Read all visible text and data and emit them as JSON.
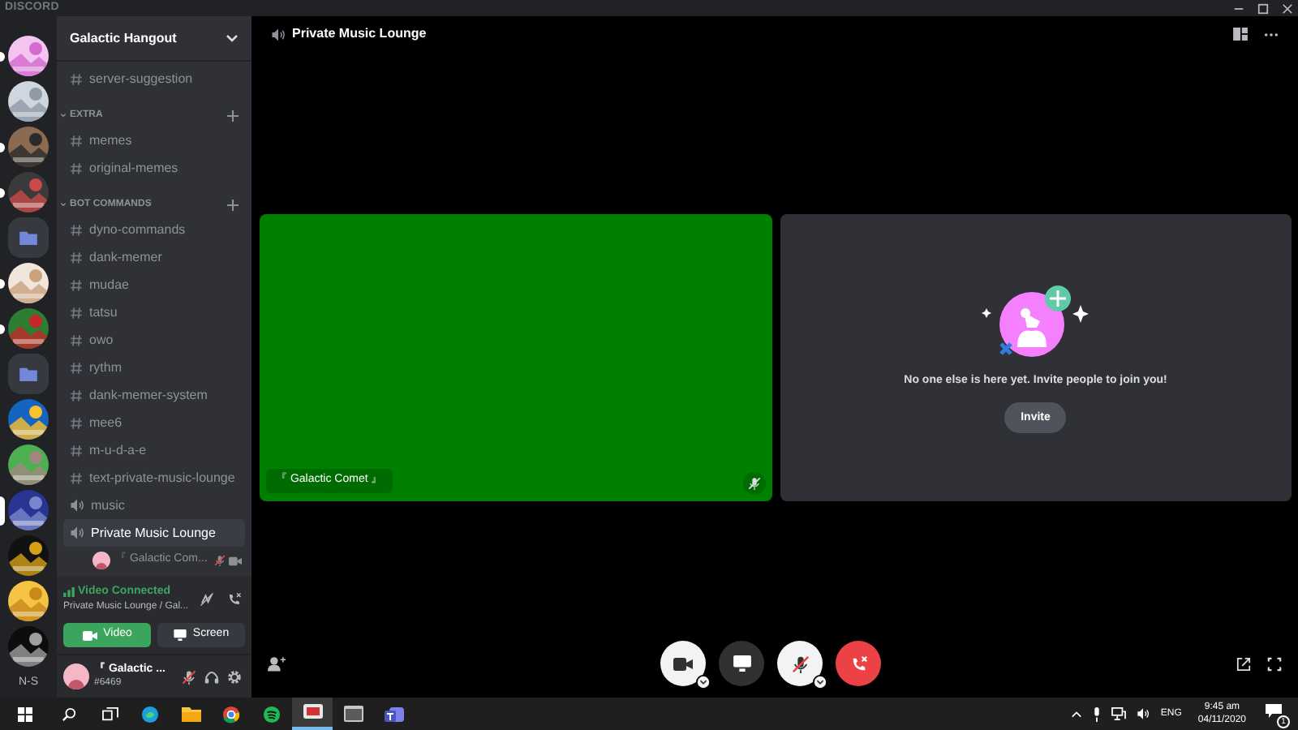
{
  "app_title": "DISCORD",
  "servers": [
    {
      "kind": "picture",
      "unread": true,
      "selected": false
    },
    {
      "kind": "picture",
      "unread": false,
      "selected": false
    },
    {
      "kind": "picture",
      "unread": true,
      "selected": false
    },
    {
      "kind": "picture",
      "unread": true,
      "selected": false
    },
    {
      "kind": "folder",
      "unread": false,
      "selected": false
    },
    {
      "kind": "picture",
      "unread": true,
      "selected": false
    },
    {
      "kind": "picture",
      "unread": true,
      "selected": false
    },
    {
      "kind": "folder",
      "unread": false,
      "selected": false
    },
    {
      "kind": "picture",
      "unread": false,
      "selected": false
    },
    {
      "kind": "picture",
      "unread": false,
      "selected": false
    },
    {
      "kind": "picture",
      "unread": false,
      "selected": true
    },
    {
      "kind": "picture",
      "unread": false,
      "selected": false
    },
    {
      "kind": "picture",
      "unread": false,
      "selected": false
    },
    {
      "kind": "picture",
      "unread": false,
      "selected": false
    }
  ],
  "server_more_label": "N-S",
  "guild_name": "Galactic Hangout",
  "channel_groups": [
    {
      "channels": [
        {
          "kind": "text",
          "name": "server-suggestion",
          "selected": false
        }
      ]
    },
    {
      "category": "EXTRA",
      "channels": [
        {
          "kind": "text",
          "name": "memes",
          "selected": false
        },
        {
          "kind": "text",
          "name": "original-memes",
          "selected": false
        }
      ]
    },
    {
      "category": "BOT COMMANDS",
      "channels": [
        {
          "kind": "text",
          "name": "dyno-commands",
          "selected": false
        },
        {
          "kind": "text",
          "name": "dank-memer",
          "selected": false
        },
        {
          "kind": "text",
          "name": "mudae",
          "selected": false
        },
        {
          "kind": "text",
          "name": "tatsu",
          "selected": false
        },
        {
          "kind": "text",
          "name": "owo",
          "selected": false
        },
        {
          "kind": "text",
          "name": "rythm",
          "selected": false
        },
        {
          "kind": "text",
          "name": "dank-memer-system",
          "selected": false
        },
        {
          "kind": "text",
          "name": "mee6",
          "selected": false
        },
        {
          "kind": "text",
          "name": "m-u-d-a-e",
          "selected": false
        },
        {
          "kind": "text",
          "name": "text-private-music-lounge",
          "selected": false
        },
        {
          "kind": "voice",
          "name": "music",
          "selected": false
        },
        {
          "kind": "voice",
          "name": "Private Music Lounge",
          "selected": true,
          "members": [
            {
              "name": "『 Galactic Com...",
              "muted": true,
              "video": true
            }
          ]
        }
      ]
    }
  ],
  "voice_status": {
    "title": "Video Connected",
    "subtitle": "Private Music Lounge / Gal..."
  },
  "voice_buttons": [
    {
      "kind": "video",
      "label": "Video",
      "selected": true
    },
    {
      "kind": "screen",
      "label": "Screen",
      "selected": false
    }
  ],
  "user": {
    "name": "『 Galactic ...",
    "tag": "#6469",
    "muted": true
  },
  "call": {
    "title": "Private Music Lounge",
    "tiles": [
      {
        "kind": "video",
        "name": "『 Galactic Comet 』",
        "muted": true
      },
      {
        "kind": "empty",
        "message": "No one else is here yet. Invite people to join you!",
        "button": "Invite"
      }
    ],
    "controls": [
      {
        "kind": "camera",
        "on": true
      },
      {
        "kind": "screen",
        "on": false
      },
      {
        "kind": "mute",
        "on": true
      },
      {
        "kind": "disconnect",
        "on": true
      }
    ]
  },
  "taskbar": {
    "apps": [
      {
        "kind": "edge",
        "selected": false
      },
      {
        "kind": "explorer",
        "selected": false
      },
      {
        "kind": "chrome",
        "selected": false
      },
      {
        "kind": "spotify",
        "selected": false
      },
      {
        "kind": "discord",
        "selected": true
      },
      {
        "kind": "window",
        "selected": false
      },
      {
        "kind": "teams",
        "selected": false
      }
    ],
    "language": "ENG",
    "time": "9:45 am",
    "date": "04/11/2020",
    "notifications": "1"
  }
}
